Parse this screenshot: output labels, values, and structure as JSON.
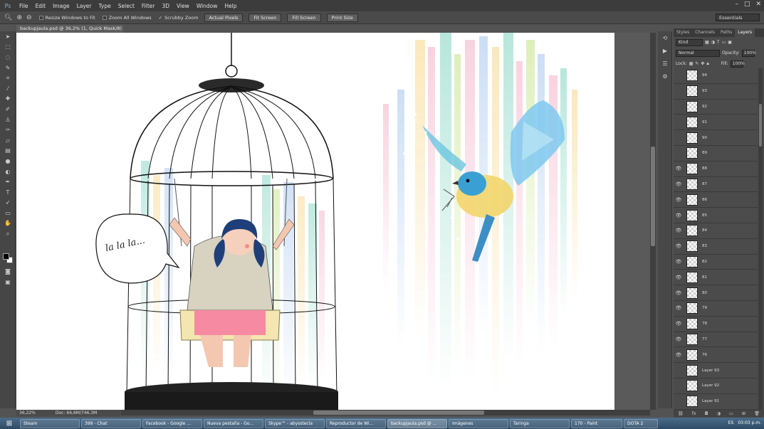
{
  "menubar": {
    "items": [
      "File",
      "Edit",
      "Image",
      "Layer",
      "Type",
      "Select",
      "Filter",
      "3D",
      "View",
      "Window",
      "Help"
    ],
    "window_controls": [
      "–",
      "□",
      "✕"
    ]
  },
  "options": {
    "resize_windows": "Resize Windows to Fit",
    "zoom_all": "Zoom All Windows",
    "scrubby_zoom": "Scrubby Zoom",
    "buttons": [
      "Actual Pixels",
      "Fit Screen",
      "Fill Screen",
      "Print Size"
    ],
    "workspace": "Essentials"
  },
  "document": {
    "tab_title": "backupjaula.psd @ 36,2% (1, Quick Mask/8) *",
    "zoom": "36,22%",
    "doc_size": "Doc: 66,6M/746,3M"
  },
  "layers_panel": {
    "tabs": [
      "Styles",
      "Channels",
      "Paths",
      "Layers"
    ],
    "active_tab": "Layers",
    "kind": "Kind",
    "blend_mode": "Normal",
    "opacity_label": "Opacity:",
    "opacity_value": "100%",
    "lock_label": "Lock:",
    "fill_label": "Fill:",
    "fill_value": "100%",
    "layers": [
      {
        "name": "94",
        "visible": false
      },
      {
        "name": "93",
        "visible": false
      },
      {
        "name": "92",
        "visible": false
      },
      {
        "name": "91",
        "visible": false
      },
      {
        "name": "90",
        "visible": false
      },
      {
        "name": "89",
        "visible": false
      },
      {
        "name": "88",
        "visible": true
      },
      {
        "name": "87",
        "visible": true
      },
      {
        "name": "86",
        "visible": true
      },
      {
        "name": "85",
        "visible": true
      },
      {
        "name": "84",
        "visible": true
      },
      {
        "name": "83",
        "visible": true
      },
      {
        "name": "82",
        "visible": true
      },
      {
        "name": "81",
        "visible": true
      },
      {
        "name": "80",
        "visible": true
      },
      {
        "name": "79",
        "visible": true
      },
      {
        "name": "78",
        "visible": true
      },
      {
        "name": "77",
        "visible": true
      },
      {
        "name": "76",
        "visible": true
      },
      {
        "name": "Layer 93",
        "visible": false
      },
      {
        "name": "Layer 92",
        "visible": false
      },
      {
        "name": "Layer 91",
        "visible": false
      }
    ]
  },
  "taskbar": {
    "tasks": [
      "Steam",
      "399 - Chat",
      "Facebook - Google ...",
      "Nueva pestaña - Go...",
      "Skype™ - abysstecla",
      "Reproductor de Wi...",
      "backupjaula.psd @ ...",
      "Imágenes",
      "Taringa",
      "170 - Paint",
      "DOTA 2"
    ],
    "active_task": "backupjaula.psd @ ...",
    "language": "ES",
    "time": "03:03 p.m."
  },
  "canvas": {
    "speech_bubble": "la la la..."
  }
}
